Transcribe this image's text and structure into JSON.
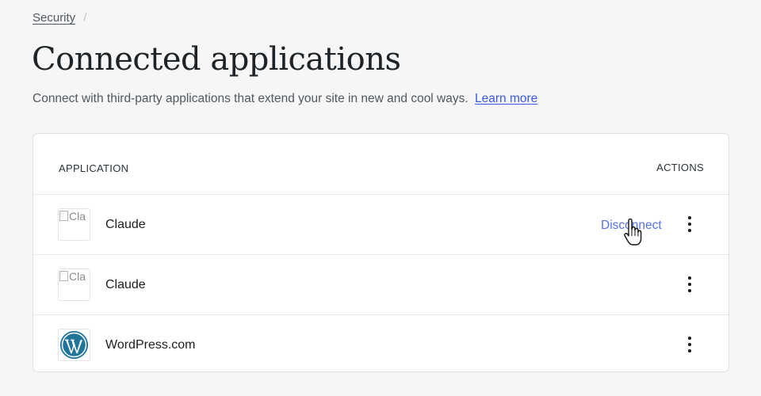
{
  "breadcrumb": {
    "security_label": "Security",
    "separator": "/"
  },
  "page": {
    "title": "Connected applications",
    "description": "Connect with third-party applications that extend your site in new and cool ways.",
    "learn_more_label": "Learn more"
  },
  "table": {
    "headers": {
      "application": "APPLICATION",
      "actions": "ACTIONS"
    },
    "rows": [
      {
        "name": "Claude",
        "icon": "broken-image-icon",
        "icon_alt_visible": "Cla",
        "action_label": "Disconnect"
      },
      {
        "name": "Claude",
        "icon": "broken-image-icon",
        "icon_alt_visible": "Cla"
      },
      {
        "name": "WordPress.com",
        "icon": "wordpress-logo-icon"
      }
    ]
  },
  "colors": {
    "accent": "#3858e9",
    "wordpress_blue": "#21759b",
    "background": "#f6f6f6"
  }
}
